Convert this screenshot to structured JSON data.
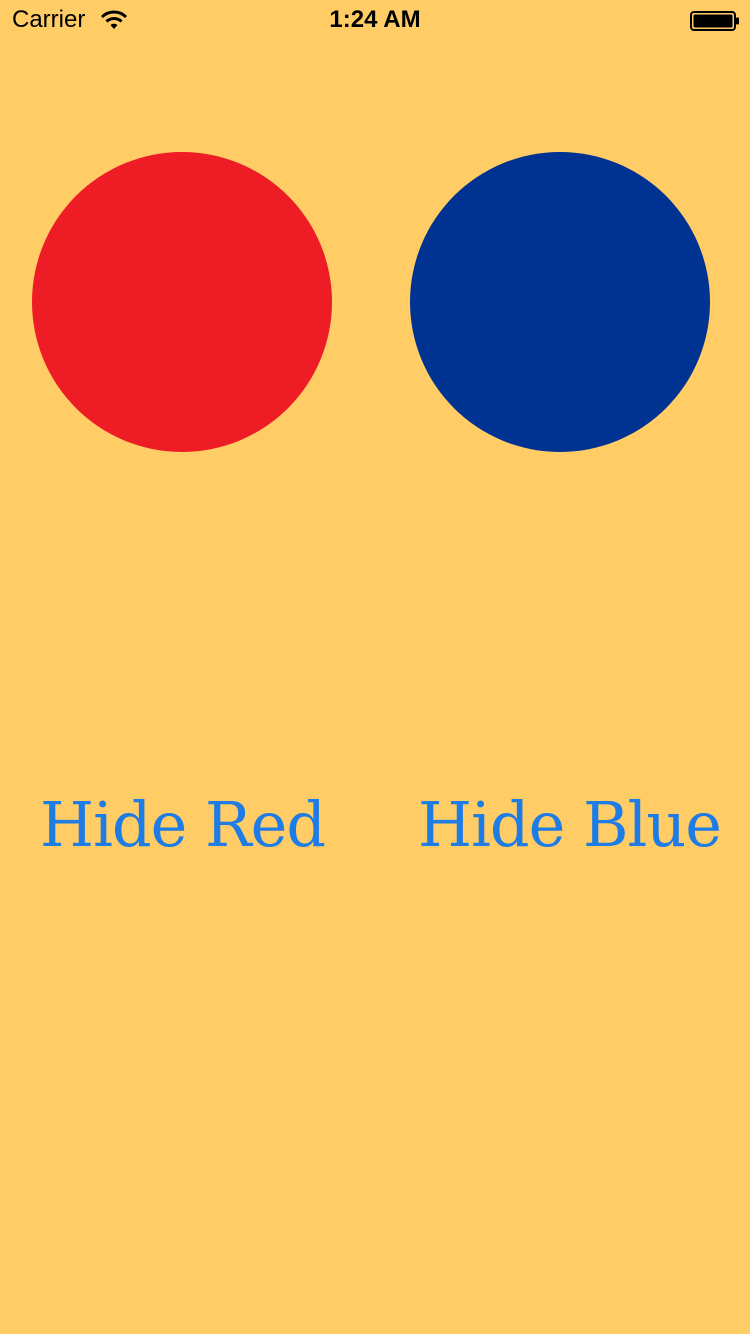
{
  "status_bar": {
    "carrier": "Carrier",
    "time": "1:24 AM",
    "wifi_icon": "wifi-icon",
    "battery_icon": "battery-icon"
  },
  "colors": {
    "background": "#FFCC66",
    "red_circle": "#EE1C25",
    "blue_circle": "#003291",
    "button_text": "#1E7CE6"
  },
  "buttons": {
    "hide_red": "Hide Red",
    "hide_blue": "Hide Blue"
  }
}
